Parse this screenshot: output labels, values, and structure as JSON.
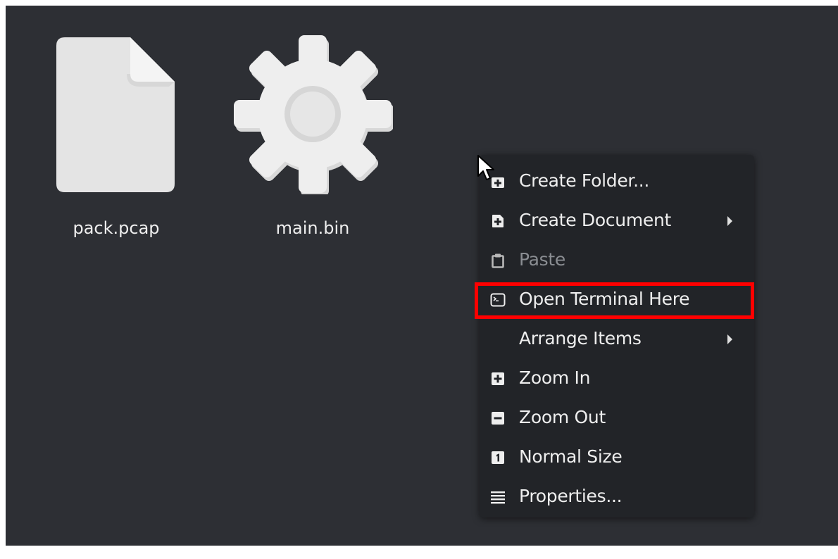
{
  "desktop": {
    "background": "#2d2f34",
    "files": [
      {
        "name": "pack.pcap",
        "icon": "document-icon"
      },
      {
        "name": "main.bin",
        "icon": "gear-icon"
      }
    ]
  },
  "context_menu": {
    "items": [
      {
        "label": "Create Folder...",
        "icon": "folder-new-icon",
        "enabled": true,
        "submenu": false
      },
      {
        "label": "Create Document",
        "icon": "document-new-icon",
        "enabled": true,
        "submenu": true
      },
      {
        "label": "Paste",
        "icon": "clipboard-icon",
        "enabled": false,
        "submenu": false
      },
      {
        "label": "Open Terminal Here",
        "icon": "terminal-icon",
        "enabled": true,
        "submenu": false,
        "highlighted": true
      },
      {
        "label": "Arrange Items",
        "icon": "",
        "enabled": true,
        "submenu": true
      },
      {
        "label": "Zoom In",
        "icon": "zoom-in-icon",
        "enabled": true,
        "submenu": false
      },
      {
        "label": "Zoom Out",
        "icon": "zoom-out-icon",
        "enabled": true,
        "submenu": false
      },
      {
        "label": "Normal Size",
        "icon": "zoom-original-icon",
        "enabled": true,
        "submenu": false
      },
      {
        "label": "Properties...",
        "icon": "properties-icon",
        "enabled": true,
        "submenu": false
      }
    ]
  },
  "annotation": {
    "highlight_color": "#ff0000"
  }
}
